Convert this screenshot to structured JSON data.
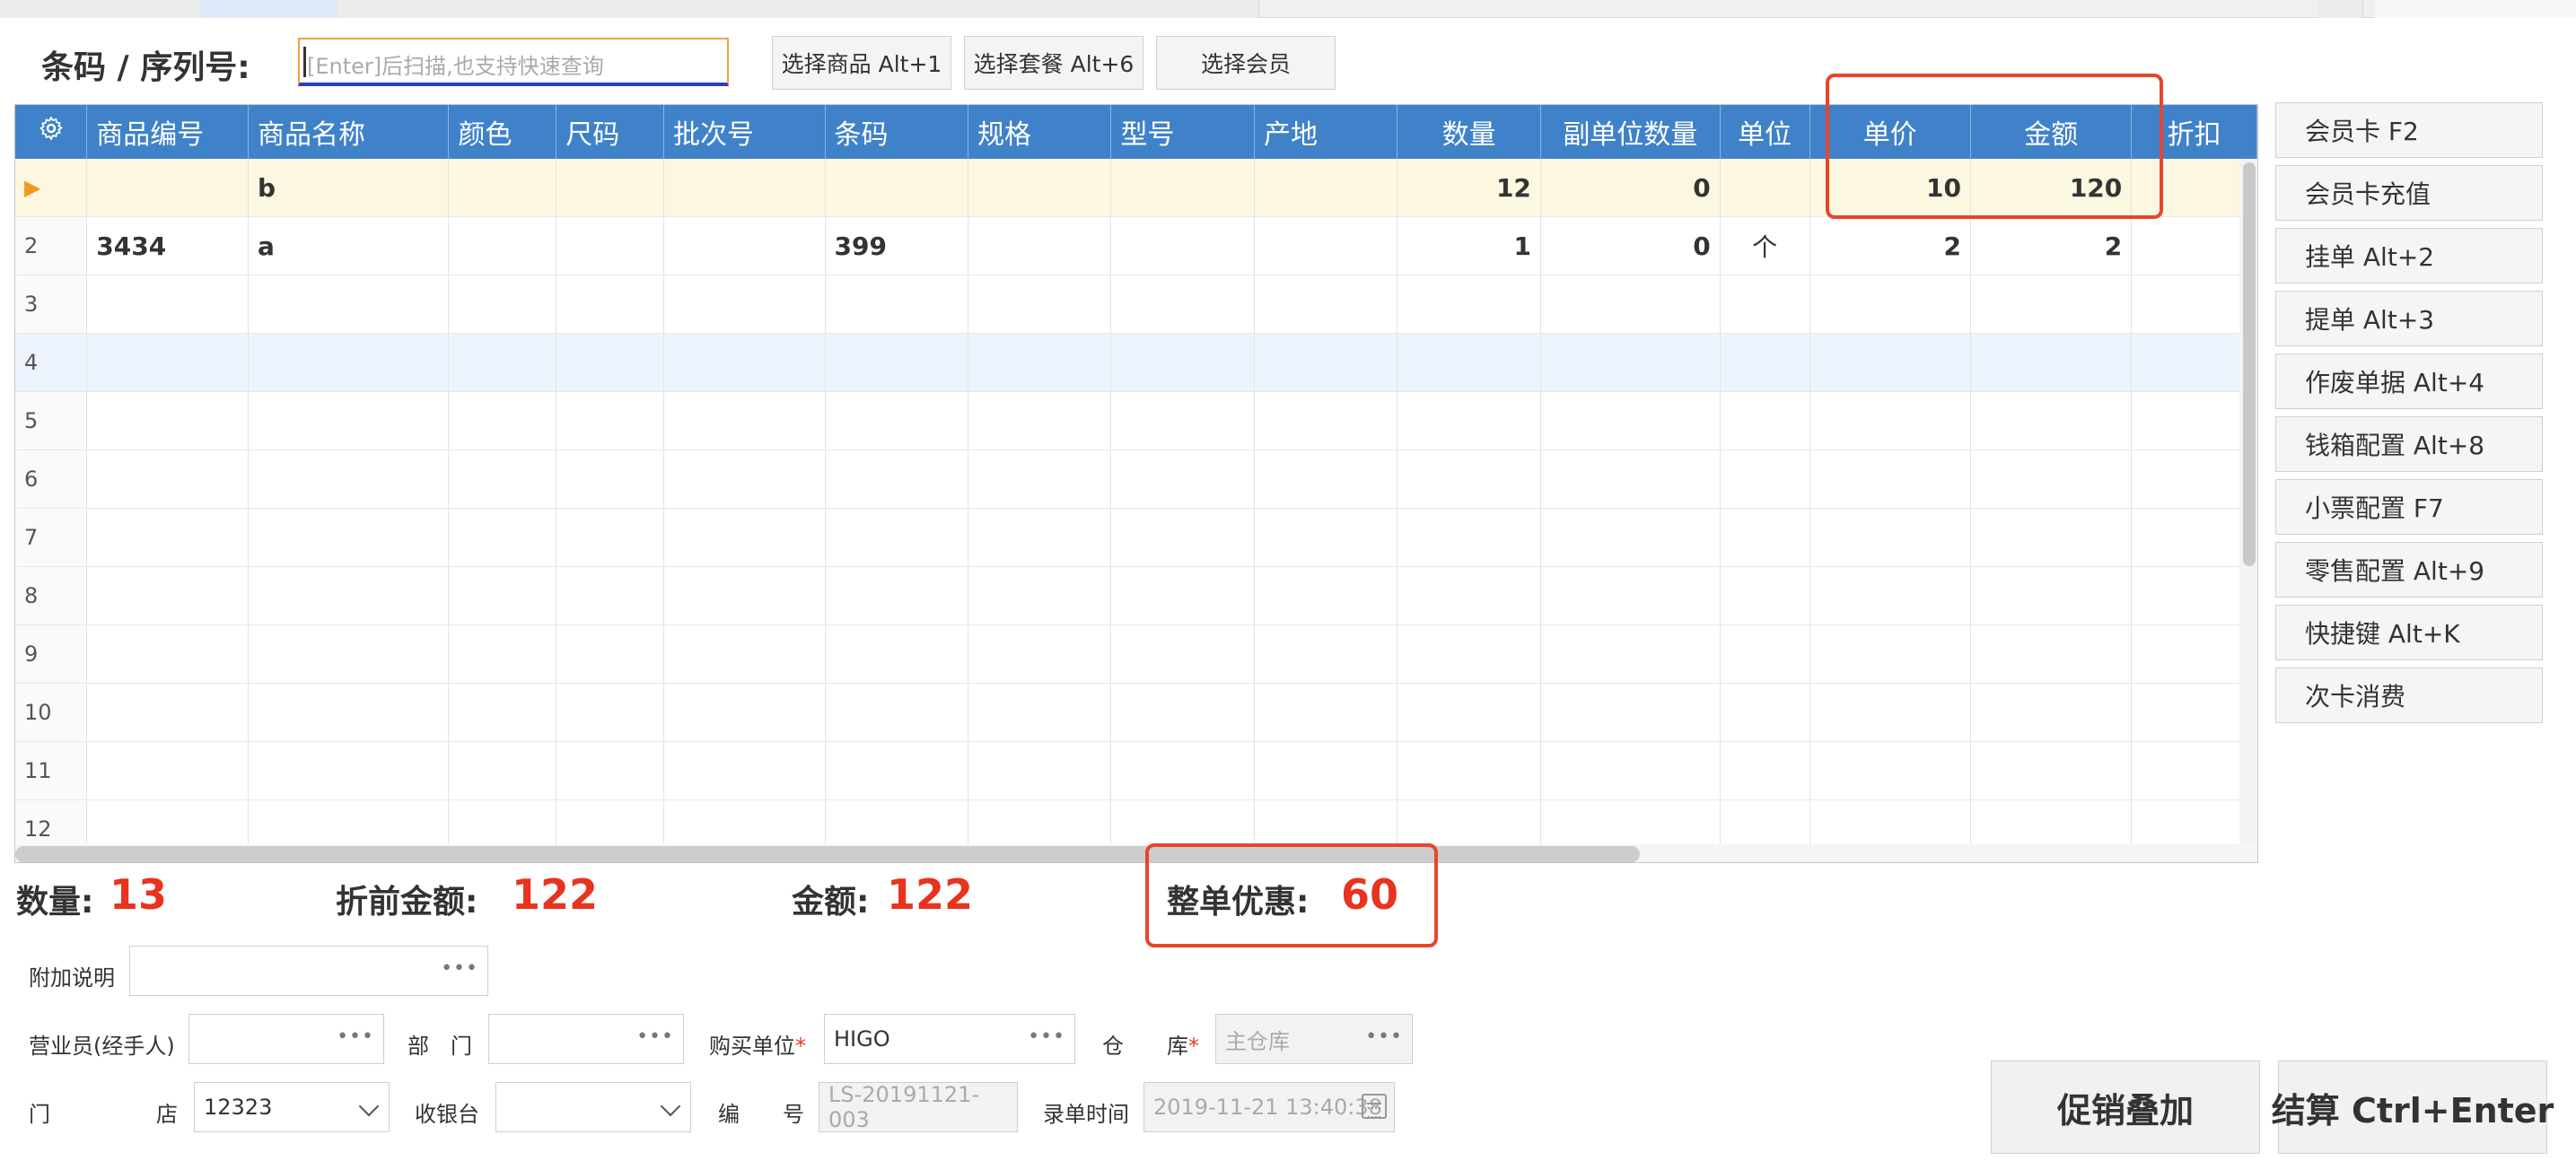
{
  "barcode": {
    "label": "条码 / 序列号:",
    "placeholder": "[Enter]后扫描,也支持快速查询"
  },
  "top_buttons": [
    "选择商品 Alt+1",
    "选择套餐 Alt+6",
    "选择会员"
  ],
  "grid": {
    "columns": [
      "商品编号",
      "商品名称",
      "颜色",
      "尺码",
      "批次号",
      "条码",
      "规格",
      "型号",
      "产地",
      "数量",
      "副单位数量",
      "单位",
      "单价",
      "金额",
      "折扣"
    ],
    "rows": [
      {
        "num": "▶",
        "code": "",
        "name": "b",
        "color": "",
        "size": "",
        "batch": "",
        "barcode": "",
        "spec": "",
        "model": "",
        "origin": "",
        "qty": "12",
        "sub_qty": "0",
        "unit": "",
        "price": "10",
        "amount": "120",
        "discount": ""
      },
      {
        "num": "2",
        "code": "3434",
        "name": "a",
        "color": "",
        "size": "",
        "batch": "",
        "barcode": "399",
        "spec": "",
        "model": "",
        "origin": "",
        "qty": "1",
        "sub_qty": "0",
        "unit": "个",
        "price": "2",
        "amount": "2",
        "discount": ""
      },
      {
        "num": "3"
      },
      {
        "num": "4"
      },
      {
        "num": "5"
      },
      {
        "num": "6"
      },
      {
        "num": "7"
      },
      {
        "num": "8"
      },
      {
        "num": "9"
      },
      {
        "num": "10"
      },
      {
        "num": "11"
      },
      {
        "num": "12"
      }
    ]
  },
  "side_buttons": [
    "会员卡 F2",
    "会员卡充值",
    "挂单 Alt+2",
    "提单 Alt+3",
    "作废单据 Alt+4",
    "钱箱配置 Alt+8",
    "小票配置 F7",
    "零售配置 Alt+9",
    "快捷键 Alt+K",
    "次卡消费"
  ],
  "summary": {
    "qty_label": "数量:",
    "qty_value": "13",
    "pre_discount_label": "折前金额:",
    "pre_discount_value": "122",
    "amount_label": "金额:",
    "amount_value": "122",
    "order_discount_label": "整单优惠:",
    "order_discount_value": "60"
  },
  "form": {
    "note_label": "附加说明",
    "salesperson_label": "营业员(经手人)",
    "dept_label": "部　门",
    "buyer_label": "购买单位",
    "buyer_value": "HIGO",
    "warehouse_label": "仓　　库",
    "warehouse_value": "主仓库",
    "store_label_1": "门",
    "store_label_2": "店",
    "store_value": "12323",
    "cashier_label": "收银台",
    "code_label": "编　　号",
    "code_value": "LS-20191121-003",
    "time_label": "录单时间",
    "time_value": "2019-11-21 13:40:38",
    "required_mark": "*"
  },
  "actions": {
    "promo": "促销叠加",
    "checkout": "结算 Ctrl+Enter"
  },
  "colors": {
    "header_blue": "#3f82c9",
    "highlight_red": "#e8452c",
    "value_red": "#e8331e",
    "selected_row": "#fbf7e1"
  }
}
